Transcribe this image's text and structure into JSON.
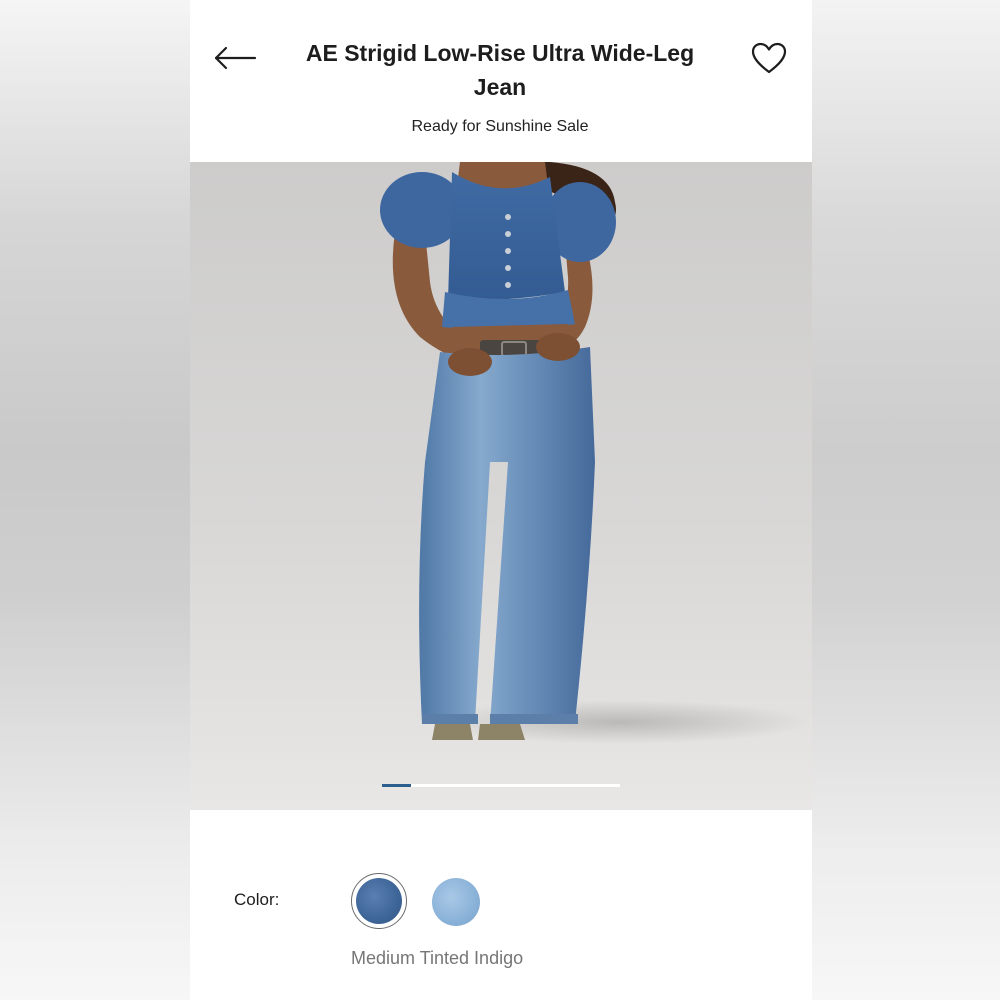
{
  "header": {
    "title": "AE Strigid Low-Rise Ultra Wide-Leg Jean",
    "subtitle": "Ready for Sunshine Sale",
    "back_icon": "arrow-left-icon",
    "favorite_icon": "heart-outline-icon"
  },
  "gallery": {
    "progress": 0.12,
    "accent_color": "#2b5f8e"
  },
  "color_selector": {
    "label": "Color:",
    "selected_name": "Medium Tinted Indigo",
    "swatches": [
      {
        "color": "#3e6597",
        "selected": true
      },
      {
        "color": "#8ab2d8",
        "selected": false
      }
    ]
  }
}
